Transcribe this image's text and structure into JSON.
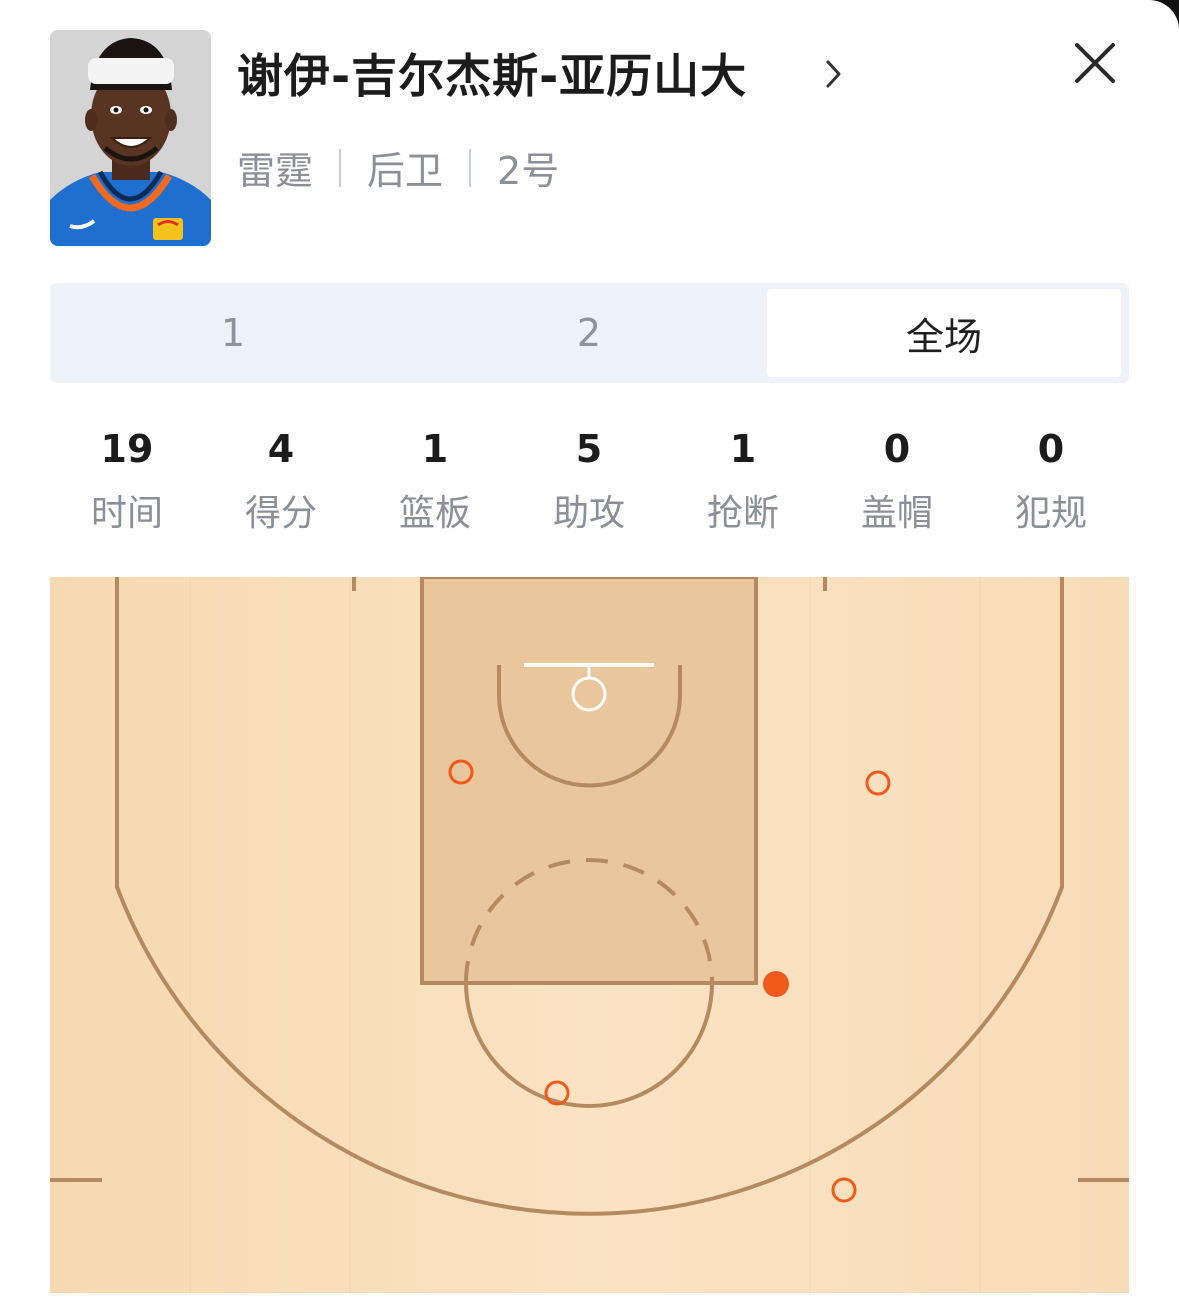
{
  "player": {
    "name": "谢伊-吉尔杰斯-亚历山大",
    "team": "雷霆",
    "position": "后卫",
    "number": "2号",
    "avatar_icon": "player-photo",
    "jersey_colors": {
      "primary": "#1e6fd0",
      "trim": "#f26a21",
      "headband": "#f4f4f4"
    }
  },
  "icons": {
    "chevron": "chevron-right-icon",
    "close": "close-icon"
  },
  "tabs": [
    {
      "label": "1",
      "active": false
    },
    {
      "label": "2",
      "active": false
    },
    {
      "label": "全场",
      "active": true
    }
  ],
  "stats": [
    {
      "value": "19",
      "label": "时间"
    },
    {
      "value": "4",
      "label": "得分"
    },
    {
      "value": "1",
      "label": "篮板"
    },
    {
      "value": "5",
      "label": "助攻"
    },
    {
      "value": "1",
      "label": "抢断"
    },
    {
      "value": "0",
      "label": "盖帽"
    },
    {
      "value": "0",
      "label": "犯规"
    }
  ],
  "colors": {
    "court_wood": "#f7dcb6",
    "paint": "#e8c397",
    "court_lines": "#b58a61",
    "shot_marker": "#f25a1c"
  }
}
